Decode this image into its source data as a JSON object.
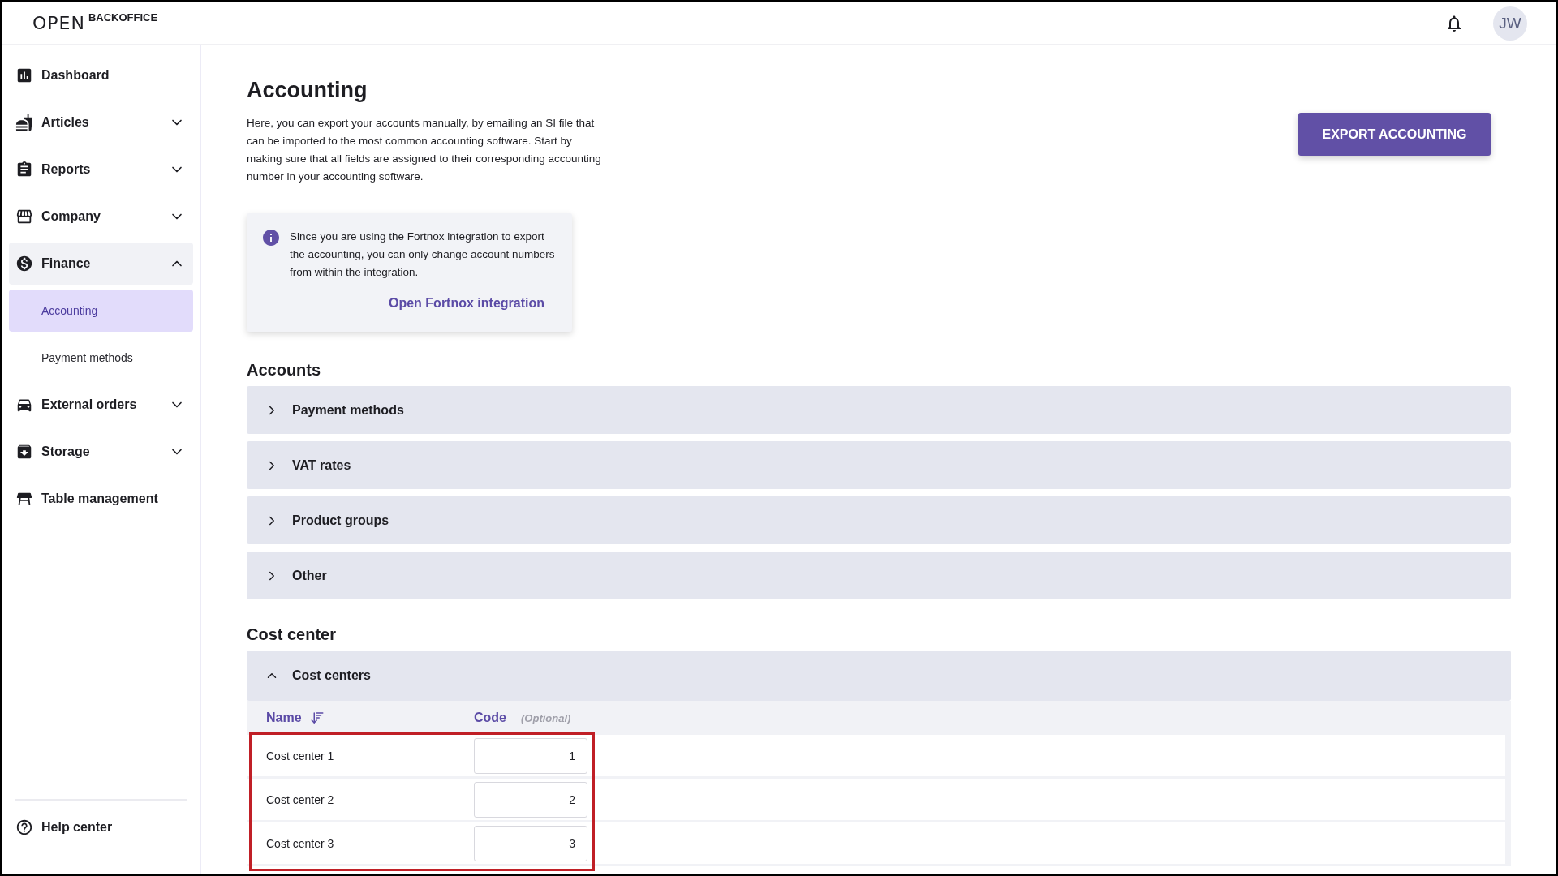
{
  "header": {
    "logo": "OPEN",
    "brand": "BACKOFFICE",
    "avatar": "JW"
  },
  "sidebar": {
    "items": [
      {
        "label": "Dashboard",
        "kind": "link"
      },
      {
        "label": "Articles",
        "kind": "group",
        "expanded": false
      },
      {
        "label": "Reports",
        "kind": "group",
        "expanded": false
      },
      {
        "label": "Company",
        "kind": "group",
        "expanded": false
      },
      {
        "label": "Finance",
        "kind": "group",
        "expanded": true,
        "children": [
          {
            "label": "Accounting",
            "selected": true
          },
          {
            "label": "Payment methods",
            "selected": false
          }
        ]
      },
      {
        "label": "External orders",
        "kind": "group",
        "expanded": false
      },
      {
        "label": "Storage",
        "kind": "group",
        "expanded": false
      },
      {
        "label": "Table management",
        "kind": "link"
      }
    ],
    "footer": {
      "label": "Help center"
    }
  },
  "page": {
    "title": "Accounting",
    "description": "Here, you can export your accounts manually, by emailing an SI file that can be imported to the most common accounting software. Start by making sure that all fields are assigned to their corresponding accounting number in your accounting software.",
    "export_button": "EXPORT ACCOUNTING",
    "notice": {
      "text": "Since you are using the Fortnox integration to export the accounting, you can only change account numbers from within the integration.",
      "link": "Open Fortnox integration"
    }
  },
  "accounts": {
    "title": "Accounts",
    "sections": [
      {
        "label": "Payment methods",
        "expanded": false
      },
      {
        "label": "VAT rates",
        "expanded": false
      },
      {
        "label": "Product groups",
        "expanded": false
      },
      {
        "label": "Other",
        "expanded": false
      }
    ]
  },
  "cost_center": {
    "title": "Cost center",
    "section": {
      "label": "Cost centers",
      "expanded": true
    },
    "columns": [
      {
        "label": "Name",
        "sorted": true
      },
      {
        "label": "Code",
        "hint": "(Optional)",
        "sorted": false
      }
    ],
    "highlighted": true,
    "rows": [
      {
        "name": "Cost center 1",
        "code": "1"
      },
      {
        "name": "Cost center 2",
        "code": "2"
      },
      {
        "name": "Cost center 3",
        "code": "3"
      }
    ]
  }
}
